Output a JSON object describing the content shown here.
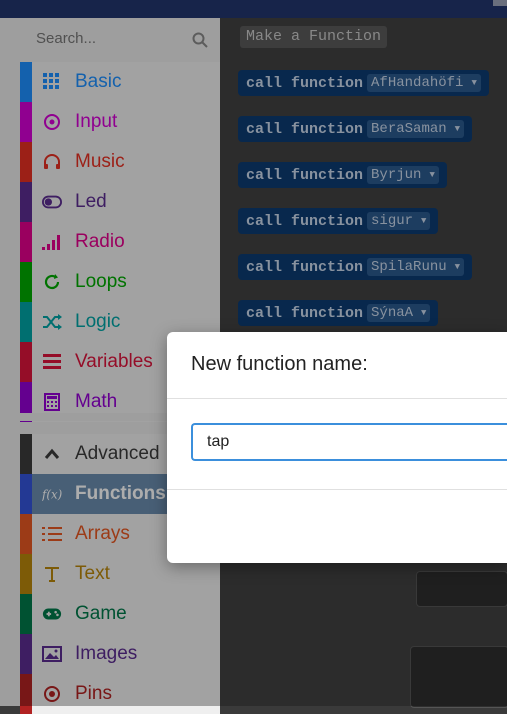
{
  "search": {
    "placeholder": "Search..."
  },
  "sidebar": {
    "categories": [
      {
        "label": "Basic",
        "color": "#1e90ff",
        "icon": "grid-icon"
      },
      {
        "label": "Input",
        "color": "#d400d4",
        "icon": "target-icon"
      },
      {
        "label": "Music",
        "color": "#e63022",
        "icon": "headphones-icon"
      },
      {
        "label": "Led",
        "color": "#5c2d91",
        "icon": "toggle-icon"
      },
      {
        "label": "Radio",
        "color": "#e3008c",
        "icon": "signal-bars-icon"
      },
      {
        "label": "Loops",
        "color": "#00aa00",
        "icon": "refresh-icon"
      },
      {
        "label": "Logic",
        "color": "#00a4a6",
        "icon": "shuffle-icon"
      },
      {
        "label": "Variables",
        "color": "#dc143c",
        "icon": "list-icon"
      },
      {
        "label": "Math",
        "color": "#9400d3",
        "icon": "calculator-icon"
      }
    ],
    "advanced": [
      {
        "label": "Advanced",
        "color": "#3c3c3c",
        "icon": "chevron-up-icon"
      },
      {
        "label": "Functions",
        "color": "#3455db",
        "icon": "function-icon"
      },
      {
        "label": "Arrays",
        "color": "#e65722",
        "icon": "list-numbered-icon"
      },
      {
        "label": "Text",
        "color": "#b8860b",
        "icon": "text-icon"
      },
      {
        "label": "Game",
        "color": "#007a4b",
        "icon": "gamepad-icon"
      },
      {
        "label": "Images",
        "color": "#5c2d91",
        "icon": "image-icon"
      },
      {
        "label": "Pins",
        "color": "#b22222",
        "icon": "pins-icon"
      }
    ]
  },
  "workspace": {
    "title": "Make a Function",
    "blocks": [
      {
        "keyword": "call function",
        "name": "AfHandahöfi"
      },
      {
        "keyword": "call function",
        "name": "BeraSaman"
      },
      {
        "keyword": "call function",
        "name": "Byrjun"
      },
      {
        "keyword": "call function",
        "name": "sigur"
      },
      {
        "keyword": "call function",
        "name": "SpilaRunu"
      },
      {
        "keyword": "call function",
        "name": "SýnaA"
      }
    ]
  },
  "dialog": {
    "title": "New function name:",
    "input_value": "tap"
  }
}
